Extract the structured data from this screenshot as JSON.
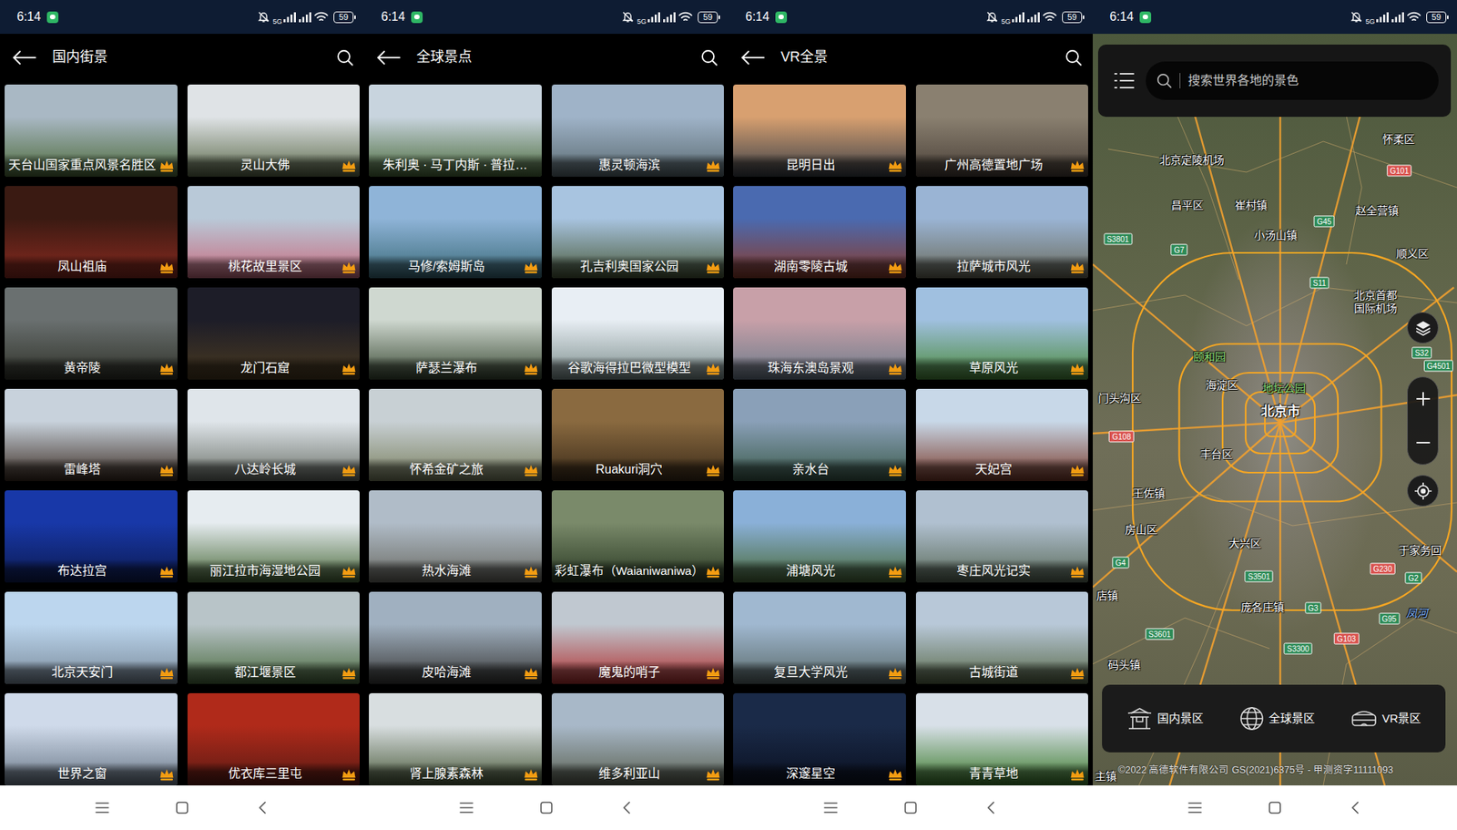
{
  "screens": [
    {
      "kind": "list",
      "status": {
        "time": "6:14",
        "network": "5G",
        "battery": "59"
      },
      "title": "国内街景",
      "tiles": [
        {
          "label": "天台山国家重点风景名胜区",
          "premium": true
        },
        {
          "label": "灵山大佛",
          "premium": true
        },
        {
          "label": "凤山祖庙",
          "premium": true
        },
        {
          "label": "桃花故里景区",
          "premium": true
        },
        {
          "label": "黄帝陵",
          "premium": true
        },
        {
          "label": "龙门石窟",
          "premium": true
        },
        {
          "label": "雷峰塔",
          "premium": true
        },
        {
          "label": "八达岭长城",
          "premium": true
        },
        {
          "label": "布达拉宫",
          "premium": true
        },
        {
          "label": "丽江拉市海湿地公园",
          "premium": true
        },
        {
          "label": "北京天安门",
          "premium": true
        },
        {
          "label": "都江堰景区",
          "premium": true
        },
        {
          "label": "世界之窗",
          "premium": true
        },
        {
          "label": "优衣库三里屯",
          "premium": true
        }
      ]
    },
    {
      "kind": "list",
      "status": {
        "time": "6:14",
        "network": "5G",
        "battery": "59"
      },
      "title": "全球景点",
      "tiles": [
        {
          "label": "朱利奥 · 马丁内斯 · 普拉…",
          "premium": false
        },
        {
          "label": "惠灵顿海滨",
          "premium": true
        },
        {
          "label": "马修/索姆斯岛",
          "premium": true
        },
        {
          "label": "孔吉利奥国家公园",
          "premium": true
        },
        {
          "label": "萨瑟兰瀑布",
          "premium": true
        },
        {
          "label": "谷歌海得拉巴微型模型",
          "premium": true
        },
        {
          "label": "怀希金矿之旅",
          "premium": true
        },
        {
          "label": "Ruakuri洞穴",
          "premium": true
        },
        {
          "label": "热水海滩",
          "premium": true
        },
        {
          "label": "彩虹瀑布（Waianiwaniwa）",
          "premium": true
        },
        {
          "label": "皮哈海滩",
          "premium": true
        },
        {
          "label": "魔鬼的哨子",
          "premium": true
        },
        {
          "label": "肾上腺素森林",
          "premium": true
        },
        {
          "label": "维多利亚山",
          "premium": true
        }
      ]
    },
    {
      "kind": "list",
      "status": {
        "time": "6:14",
        "network": "5G",
        "battery": "59"
      },
      "title": "VR全景",
      "tiles": [
        {
          "label": "昆明日出",
          "premium": true
        },
        {
          "label": "广州高德置地广场",
          "premium": true
        },
        {
          "label": "湖南零陵古城",
          "premium": true
        },
        {
          "label": "拉萨城市风光",
          "premium": true
        },
        {
          "label": "珠海东澳岛景观",
          "premium": true
        },
        {
          "label": "草原风光",
          "premium": true
        },
        {
          "label": "亲水台",
          "premium": true
        },
        {
          "label": "天妃宫",
          "premium": true
        },
        {
          "label": "浦塘风光",
          "premium": true
        },
        {
          "label": "枣庄风光记实",
          "premium": true
        },
        {
          "label": "复旦大学风光",
          "premium": true
        },
        {
          "label": "古城街道",
          "premium": true
        },
        {
          "label": "深邃星空",
          "premium": true
        },
        {
          "label": "青青草地",
          "premium": true
        }
      ]
    },
    {
      "kind": "map",
      "status": {
        "time": "6:14",
        "network": "5G",
        "battery": "59"
      },
      "search": {
        "placeholder": "搜索世界各地的景色"
      },
      "labels": [
        {
          "text": "怀柔区",
          "kind": "place"
        },
        {
          "text": "北京定陵机场",
          "kind": "place"
        },
        {
          "text": "昌平区",
          "kind": "place"
        },
        {
          "text": "崔村镇",
          "kind": "place"
        },
        {
          "text": "赵全营镇",
          "kind": "place"
        },
        {
          "text": "小汤山镇",
          "kind": "place"
        },
        {
          "text": "顺义区",
          "kind": "place"
        },
        {
          "text": "北京首都国际机场",
          "kind": "stacked"
        },
        {
          "text": "颐和园",
          "kind": "park"
        },
        {
          "text": "海淀区",
          "kind": "place"
        },
        {
          "text": "地坛公园",
          "kind": "park"
        },
        {
          "text": "北京市",
          "kind": "city"
        },
        {
          "text": "门头沟区",
          "kind": "place"
        },
        {
          "text": "丰台区",
          "kind": "place"
        },
        {
          "text": "王佐镇",
          "kind": "place"
        },
        {
          "text": "房山区",
          "kind": "place"
        },
        {
          "text": "大兴区",
          "kind": "place"
        },
        {
          "text": "于家务回",
          "kind": "place"
        },
        {
          "text": "店镇",
          "kind": "place"
        },
        {
          "text": "庞各庄镇",
          "kind": "place"
        },
        {
          "text": "码头镇",
          "kind": "place"
        },
        {
          "text": "主镇",
          "kind": "place"
        },
        {
          "text": "凤河",
          "kind": "water"
        },
        {
          "text": "G101",
          "kind": "road",
          "color": "#d9534f"
        },
        {
          "text": "G45",
          "kind": "road",
          "color": "#2e8b57"
        },
        {
          "text": "S3801",
          "kind": "road",
          "color": "#2e8b57"
        },
        {
          "text": "G7",
          "kind": "road",
          "color": "#2e8b57"
        },
        {
          "text": "S11",
          "kind": "road",
          "color": "#2e8b57"
        },
        {
          "text": "S32",
          "kind": "road",
          "color": "#2e8b57"
        },
        {
          "text": "G4501",
          "kind": "road",
          "color": "#2e8b57"
        },
        {
          "text": "G108",
          "kind": "road",
          "color": "#d9534f"
        },
        {
          "text": "G4",
          "kind": "road",
          "color": "#2e8b57"
        },
        {
          "text": "G230",
          "kind": "road",
          "color": "#d9534f"
        },
        {
          "text": "S3501",
          "kind": "road",
          "color": "#2e8b57"
        },
        {
          "text": "G2",
          "kind": "road",
          "color": "#2e8b57"
        },
        {
          "text": "G3",
          "kind": "road",
          "color": "#2e8b57"
        },
        {
          "text": "G95",
          "kind": "road",
          "color": "#2e8b57"
        },
        {
          "text": "S3601",
          "kind": "road",
          "color": "#2e8b57"
        },
        {
          "text": "G103",
          "kind": "road",
          "color": "#d9534f"
        },
        {
          "text": "S3300",
          "kind": "road",
          "color": "#2e8b57"
        }
      ],
      "buttons": [
        {
          "label": "国内景区"
        },
        {
          "label": "全球景区"
        },
        {
          "label": "VR景区"
        }
      ],
      "copyright": "©2022 高德软件有限公司 GS(2021)6375号 - 甲测资字11111093"
    }
  ]
}
